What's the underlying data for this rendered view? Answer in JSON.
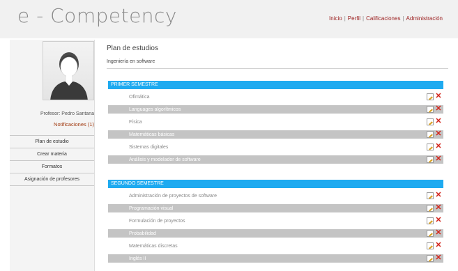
{
  "app": {
    "title": "e - Competency"
  },
  "topnav": {
    "items": [
      "Inicio",
      "Perfil",
      "Calificaciones",
      "Administración"
    ]
  },
  "sidebar": {
    "teacher": "Profesor: Pedro Santana",
    "notifications": "Notificaciones (1)",
    "menu": [
      "Plan de estudio",
      "Crear materia",
      "Formatos",
      "Asignación de profesores"
    ]
  },
  "main": {
    "title": "Plan de estudios",
    "program": "Ingeniería en software"
  },
  "semesters": [
    {
      "name": "PRIMER SEMESTRE",
      "subjects": [
        "Ofimática",
        "Languages algorítmicos",
        "Física",
        "Matemáticas básicas",
        "Sistemas digitales",
        "Análisis y modelador de software"
      ]
    },
    {
      "name": "SEGUNDO SEMESTRE",
      "subjects": [
        "Administración de proyectos de software",
        "Programación visual",
        "Formulación de proyectos",
        "Probabilidad",
        "Matemáticas discretas",
        "Inglés II"
      ]
    }
  ],
  "icons": {
    "edit": "edit-icon",
    "delete": "delete-icon"
  },
  "colors": {
    "accent": "#1eaaf0",
    "link": "#9a1d1d",
    "delete": "#d2241a"
  }
}
